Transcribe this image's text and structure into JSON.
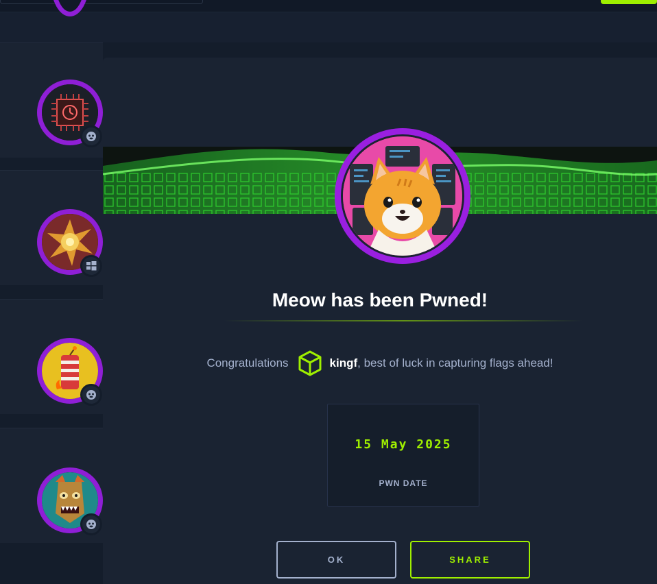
{
  "modal": {
    "title": "Meow has been Pwned!",
    "congrats_prefix": "Congratulations",
    "username": "kingf",
    "congrats_suffix": ", best of luck in capturing flags ahead!",
    "pwn_date": "15 May 2025",
    "pwn_date_label": "PWN DATE",
    "ok_label": "OK",
    "share_label": "SHARE",
    "user_icon": "hexagon-cube-icon",
    "machine_avatar": "cat-avatar"
  },
  "machine_list": [
    {
      "avatar": "cpu-chip-avatar",
      "os": "linux-icon"
    },
    {
      "avatar": "explosion-avatar",
      "os": "windows-icon"
    },
    {
      "avatar": "dynamite-avatar",
      "os": "linux-icon"
    },
    {
      "avatar": "tiki-mask-avatar",
      "os": "linux-icon"
    }
  ],
  "colors": {
    "accent": "#9fef00",
    "ring": "#8f1fd6",
    "background": "#141d2b",
    "panel": "#1a2332",
    "muted_text": "#a4b1cd"
  }
}
